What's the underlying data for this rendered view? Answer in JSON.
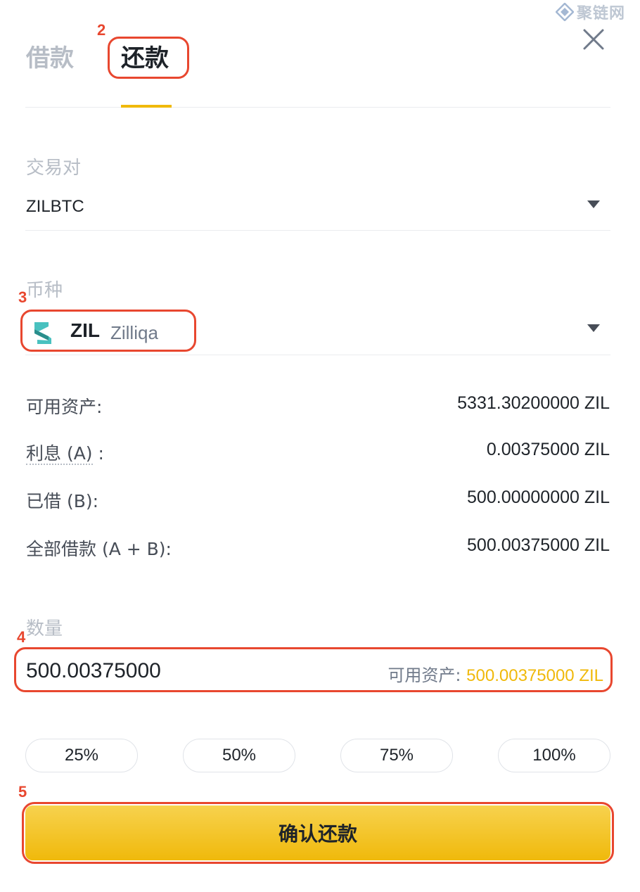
{
  "watermark": {
    "text": "聚链网"
  },
  "tabs": {
    "borrow": "借款",
    "repay": "还款"
  },
  "callouts": {
    "n2": "2",
    "n3": "3",
    "n4": "4",
    "n5": "5"
  },
  "pair": {
    "label": "交易对",
    "value": "ZILBTC"
  },
  "coin": {
    "label": "币种",
    "symbol": "ZIL",
    "name": "Zilliqa"
  },
  "info": {
    "available_label": "可用资产:",
    "available_value": "5331.30200000 ZIL",
    "interest_label": "利息 (A)",
    "interest_colon": ":",
    "interest_value": "0.00375000 ZIL",
    "borrowed_label": "已借 (B):",
    "borrowed_value": "500.00000000 ZIL",
    "total_label": "全部借款 (A + B):",
    "total_value": "500.00375000 ZIL"
  },
  "amount": {
    "label": "数量",
    "value": "500.00375000",
    "avail_label": "可用资产: ",
    "avail_value": "500.00375000 ZIL"
  },
  "percent_buttons": [
    "25%",
    "50%",
    "75%",
    "100%"
  ],
  "confirm_label": "确认还款",
  "colors": {
    "accent": "#f0b90b",
    "annotation": "#e8472f"
  }
}
